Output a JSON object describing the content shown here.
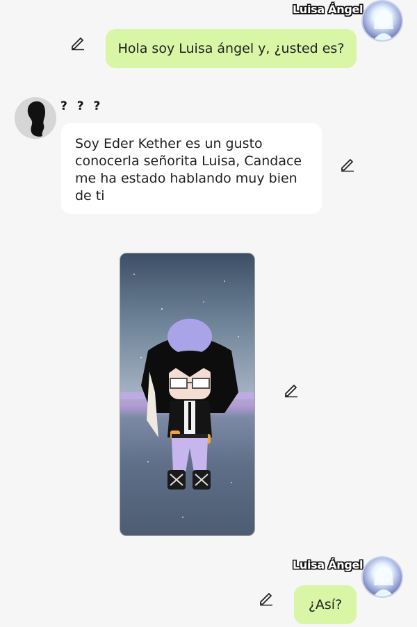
{
  "messages": [
    {
      "sender": "Luisa Ángel",
      "text": "Hola soy Luisa ángel y, ¿usted es?"
    },
    {
      "sender": "? ? ?",
      "text": "Soy Eder Kether es un gusto conocerla señorita Luisa, Candace me ha estado hablando muy bien de ti"
    },
    {
      "sender": "Luisa Ángel",
      "text": "¿Así?"
    }
  ],
  "icons": {
    "edit": "pencil-edit-icon",
    "avatar_right": "character-avatar-icon",
    "avatar_left": "silhouette-avatar-icon"
  },
  "colors": {
    "background": "#f6f6f6",
    "outgoing_bubble": "#d9f5a6",
    "incoming_bubble": "#ffffff"
  }
}
